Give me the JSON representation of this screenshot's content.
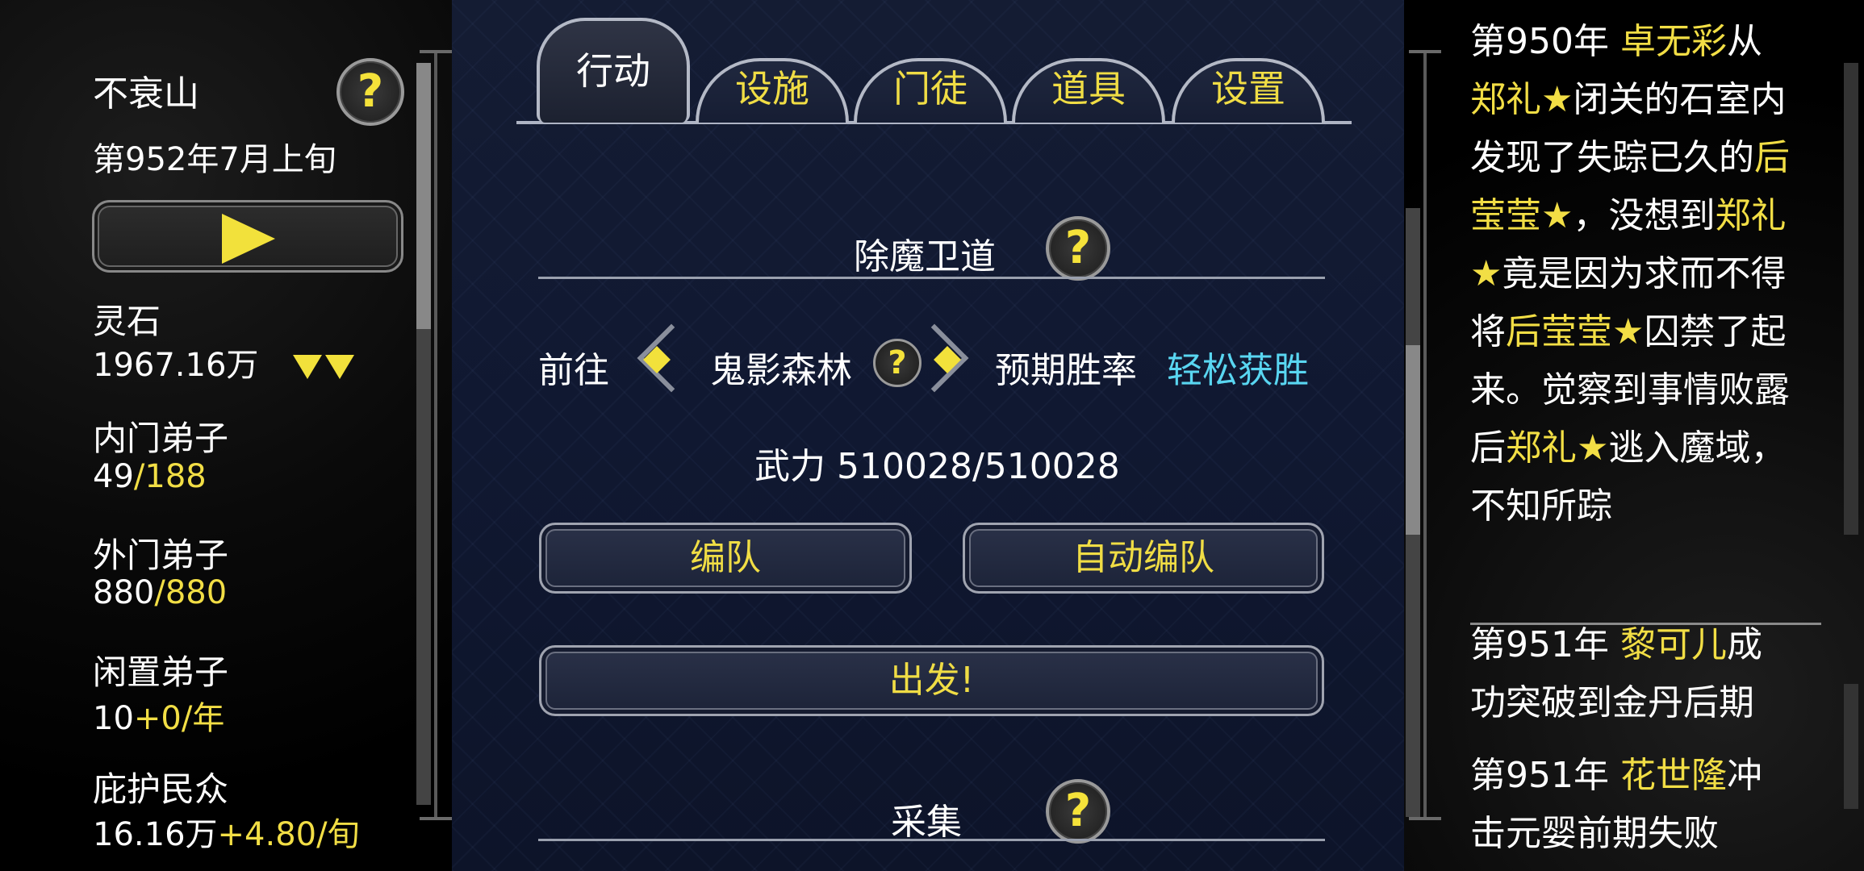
{
  "sect": {
    "name": "不衰山",
    "date": "第952年7月上旬"
  },
  "stats": {
    "spirit_stone": {
      "label": "灵石",
      "value": "1967.16万"
    },
    "inner_disciples": {
      "label": "内门弟子",
      "current": "49",
      "max": "/188"
    },
    "outer_disciples": {
      "label": "外门弟子",
      "current": "880",
      "max": "/880"
    },
    "idle_disciples": {
      "label": "闲置弟子",
      "current": "10",
      "rate": "+0/年"
    },
    "protected_people": {
      "label": "庇护民众",
      "current": "16.16万",
      "rate": "+4.80/旬"
    }
  },
  "help_glyph": "?",
  "tabs": [
    "行动",
    "设施",
    "门徒",
    "道具",
    "设置"
  ],
  "mission": {
    "title": "除魔卫道",
    "go_label": "前往",
    "location": "鬼影森林",
    "expected_label": "预期胜率",
    "expected_value": "轻松获胜",
    "power": "武力 510028/510028",
    "formation_button": "编队",
    "auto_formation_button": "自动编队",
    "depart_button": "出发!"
  },
  "gather": {
    "title": "采集"
  },
  "log": [
    {
      "segments": [
        {
          "t": "第950年 ",
          "c": "w"
        },
        {
          "t": "卓无彩",
          "c": "y"
        },
        {
          "t": "从",
          "c": "w"
        },
        {
          "t": "郑礼★",
          "c": "y"
        },
        {
          "t": "闭关的石室内发现了失踪已久的",
          "c": "w"
        },
        {
          "t": "后莹莹★",
          "c": "y"
        },
        {
          "t": "，没想到",
          "c": "w"
        },
        {
          "t": "郑礼★",
          "c": "y"
        },
        {
          "t": "竟是因为求而不得将",
          "c": "w"
        },
        {
          "t": "后莹莹★",
          "c": "y"
        },
        {
          "t": "囚禁了起来。觉察到事情败露后",
          "c": "w"
        },
        {
          "t": "郑礼★",
          "c": "y"
        },
        {
          "t": "逃入魔域，不知所踪",
          "c": "w"
        }
      ]
    },
    {
      "segments": [
        {
          "t": "第951年 ",
          "c": "w"
        },
        {
          "t": "黎可儿",
          "c": "y"
        },
        {
          "t": "成功突破到金丹后期",
          "c": "w"
        }
      ]
    },
    {
      "segments": [
        {
          "t": "第951年 ",
          "c": "w"
        },
        {
          "t": "花世隆",
          "c": "y"
        },
        {
          "t": "冲击元婴前期失败",
          "c": "w"
        }
      ]
    }
  ]
}
